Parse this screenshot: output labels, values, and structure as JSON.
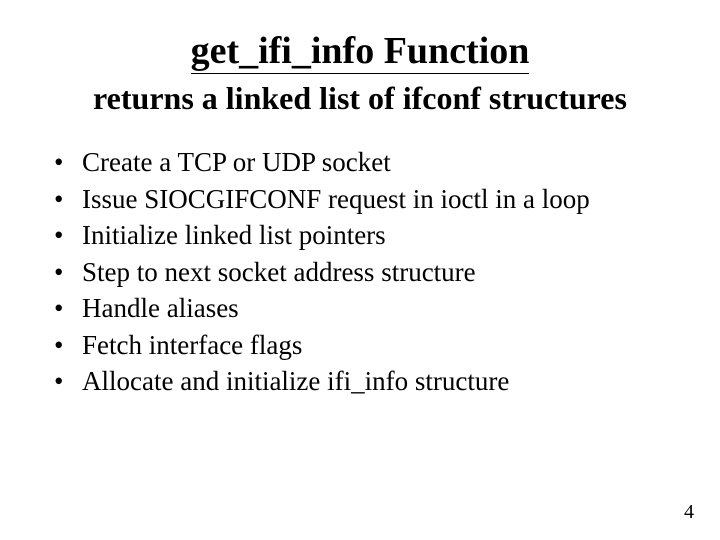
{
  "slide": {
    "title": "get_ifi_info Function",
    "subtitle": "returns a linked list of ifconf structures",
    "bullets": [
      "Create a TCP or UDP socket",
      "Issue SIOCGIFCONF request in ioctl in a loop",
      "Initialize linked list pointers",
      "Step to next socket address structure",
      "Handle aliases",
      "Fetch interface flags",
      "Allocate and initialize ifi_info structure"
    ],
    "page_number": "4"
  }
}
